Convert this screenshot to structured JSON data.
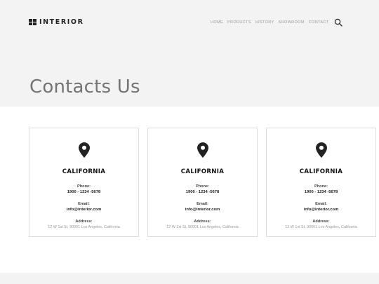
{
  "brand": {
    "logo_text": "INTERIOR"
  },
  "nav": {
    "items": [
      "HOME",
      "PRODUCTS",
      "HISTORY",
      "SHOWROOM",
      "CONTACT"
    ],
    "search_icon": "search-icon"
  },
  "hero": {
    "title": "Contacts Us"
  },
  "cards": [
    {
      "icon": "map-pin-icon",
      "city": "CALIFORNIA",
      "phone_label": "Phone:",
      "phone": "1900 - 1234 -5678",
      "email_label": "Email:",
      "email": "info@interior.com",
      "address_label": "Address:",
      "address": "12 W 1st St, 90001 Los Angeles, California"
    },
    {
      "icon": "map-pin-icon",
      "city": "CALIFORNIA",
      "phone_label": "Phone:",
      "phone": "1900 - 1234 -5678",
      "email_label": "Email:",
      "email": "info@interior.com",
      "address_label": "Address:",
      "address": "12 W 1st St, 90001 Los Angeles, California"
    },
    {
      "icon": "map-pin-icon",
      "city": "CALIFORNIA",
      "phone_label": "Phone:",
      "phone": "1900 - 1234 -5678",
      "email_label": "Email:",
      "email": "info@interior.com",
      "address_label": "Address:",
      "address": "12 W 1st St, 90001 Los Angeles, California"
    }
  ],
  "colors": {
    "hero_bg": "#f3f3f3",
    "text_dark": "#222222",
    "nav_text": "#9a9a9a",
    "border": "#dcdcdc"
  }
}
